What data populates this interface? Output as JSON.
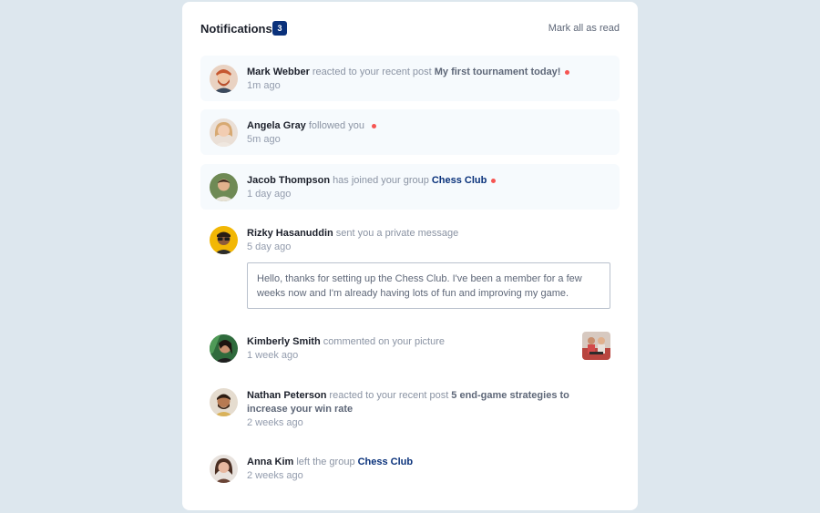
{
  "header": {
    "title": "Notifications",
    "count": "3",
    "mark_all": "Mark all as read"
  },
  "notifications": [
    {
      "avatar_icon": "avatar-mark-webber",
      "name": "Mark Webber",
      "action": "reacted to your recent post",
      "target": "My first tournament today!",
      "time": "1m ago",
      "unread": true
    },
    {
      "avatar_icon": "avatar-angela-gray",
      "name": "Angela Gray",
      "action": "followed you",
      "time": "5m ago",
      "unread": true
    },
    {
      "avatar_icon": "avatar-jacob-thompson",
      "name": "Jacob Thompson",
      "action": "has joined your group",
      "target": "Chess Club",
      "time": "1 day ago",
      "unread": true
    },
    {
      "avatar_icon": "avatar-rizky-hasanuddin",
      "name": "Rizky Hasanuddin",
      "action": "sent you a private message",
      "time": "5 day ago",
      "message": "Hello, thanks for setting up the Chess Club. I've been a member for a few weeks now and I'm already having lots of fun and improving my game.",
      "unread": false
    },
    {
      "avatar_icon": "avatar-kimberly-smith",
      "name": "Kimberly Smith",
      "action": "commented on your picture",
      "time": "1 week ago",
      "picture_icon": "chess-picture-thumbnail",
      "unread": false
    },
    {
      "avatar_icon": "avatar-nathan-peterson",
      "name": "Nathan Peterson",
      "action": "reacted to your recent post",
      "target": "5 end-game strategies to increase your win rate",
      "time": "2 weeks ago",
      "unread": false
    },
    {
      "avatar_icon": "avatar-anna-kim",
      "name": "Anna Kim",
      "action": "left the group",
      "target": "Chess Club",
      "time": "2 weeks ago",
      "unread": false
    }
  ],
  "colors": {
    "page_bg": "#dde7ee",
    "unread_bg": "#f6fafd",
    "badge": "#0a317b",
    "dot": "#f65552",
    "group_link": "#0a327b"
  }
}
